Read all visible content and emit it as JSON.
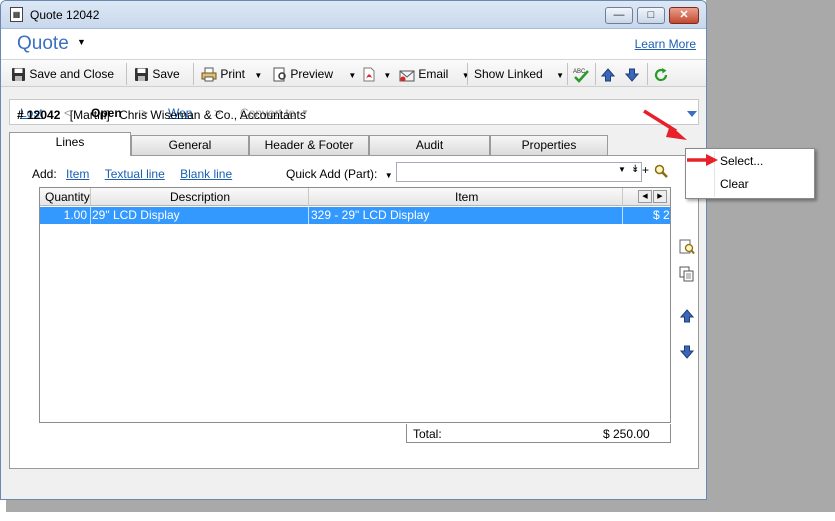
{
  "window": {
    "title": "Quote 12042",
    "buttons": {
      "minimize": "minimize",
      "maximize": "maximize",
      "close": "close"
    }
  },
  "header": {
    "title": "Quote",
    "learn_more": "Learn More"
  },
  "toolbar": {
    "save_close": "Save and Close",
    "save": "Save",
    "print": "Print",
    "preview": "Preview",
    "email": "Email",
    "show_linked": "Show Linked"
  },
  "status": {
    "lost": "Lost",
    "open": "Open",
    "won": "Won",
    "convert_to": "Convert to",
    "separator": "<",
    "separator2": ">"
  },
  "info": {
    "number": "# 12042",
    "owner": "[Martin]",
    "customer": "Chris Wiseman & Co., Accountants"
  },
  "tabs": [
    "Lines",
    "General",
    "Header & Footer",
    "Audit",
    "Properties"
  ],
  "lines": {
    "add_label": "Add:",
    "add_item": "Item",
    "add_textual": "Textual line",
    "add_blank": "Blank line",
    "quick_add_label": "Quick Add (Part):",
    "columns": {
      "quantity": "Quantity",
      "description": "Description",
      "item": "Item"
    },
    "rows": [
      {
        "quantity": "1.00",
        "description": "29\" LCD Display",
        "item": "329 - 29\" LCD Display",
        "amount": "$ 2"
      }
    ],
    "total_label": "Total:",
    "total_value": "$ 250.00"
  },
  "context_menu": {
    "select": "Select...",
    "clear": "Clear"
  },
  "colors": {
    "accent": "#3a6fc4",
    "selection": "#3399ff",
    "arrow": "#e8202a"
  }
}
